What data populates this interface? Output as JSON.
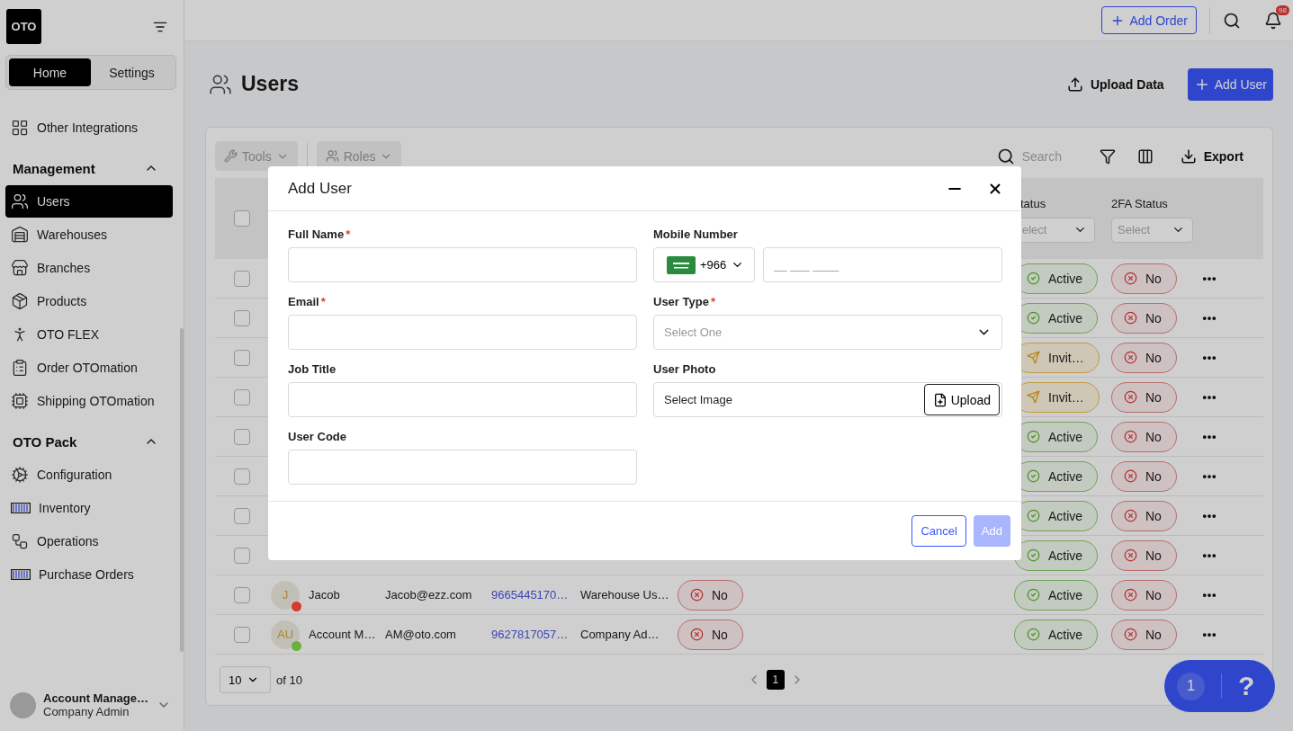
{
  "sidebar": {
    "logo": "OTO",
    "tabs": [
      {
        "label": "Home",
        "selected": true
      },
      {
        "label": "Settings",
        "selected": false
      }
    ],
    "groups": [
      {
        "items": [
          {
            "label": "Other Integrations",
            "selected": false
          }
        ]
      },
      {
        "title": "Management",
        "expanded": true,
        "items": [
          {
            "label": "Users",
            "selected": true
          },
          {
            "label": "Warehouses",
            "selected": false
          },
          {
            "label": "Branches",
            "selected": false
          },
          {
            "label": "Products",
            "selected": false
          },
          {
            "label": "OTO FLEX",
            "selected": false
          },
          {
            "label": "Order OTOmation",
            "selected": false
          },
          {
            "label": "Shipping OTOmation",
            "selected": false
          }
        ]
      },
      {
        "title": "OTO Pack",
        "expanded": true,
        "items": [
          {
            "label": "Configuration",
            "selected": false
          },
          {
            "label": "Inventory",
            "selected": false
          },
          {
            "label": "Operations",
            "selected": false
          },
          {
            "label": "Purchase Orders",
            "selected": false
          }
        ]
      }
    ],
    "account": {
      "name": "Account Manage…",
      "role": "Company Admin"
    }
  },
  "header": {
    "add_order": "Add Order",
    "notification_count": "98"
  },
  "page": {
    "title": "Users",
    "upload": "Upload Data",
    "add": "Add User"
  },
  "toolbar": {
    "tools": "Tools",
    "roles": "Roles",
    "search_placeholder": "Search",
    "export": "Export"
  },
  "table": {
    "header_checked": false,
    "columns": [
      {
        "label": "tatus",
        "filter_placeholder": "elect"
      },
      {
        "label": "2FA Status",
        "filter_placeholder": "Select"
      }
    ],
    "rows": [
      {
        "checked": false,
        "status": {
          "text": "Active",
          "kind": "active"
        },
        "twofa": {
          "text": "No",
          "kind": "no"
        }
      },
      {
        "checked": false,
        "status": {
          "text": "Active",
          "kind": "active"
        },
        "twofa": {
          "text": "No",
          "kind": "no"
        }
      },
      {
        "checked": false,
        "status": {
          "text": "Invit…",
          "kind": "invited"
        },
        "twofa": {
          "text": "No",
          "kind": "no"
        }
      },
      {
        "checked": false,
        "status": {
          "text": "Invit…",
          "kind": "invited"
        },
        "twofa": {
          "text": "No",
          "kind": "no"
        }
      },
      {
        "checked": false,
        "status": {
          "text": "Active",
          "kind": "active"
        },
        "twofa": {
          "text": "No",
          "kind": "no"
        }
      },
      {
        "checked": false,
        "status": {
          "text": "Active",
          "kind": "active"
        },
        "twofa": {
          "text": "No",
          "kind": "no"
        }
      },
      {
        "checked": false,
        "status": {
          "text": "Active",
          "kind": "active"
        },
        "twofa": {
          "text": "No",
          "kind": "no"
        }
      },
      {
        "checked": false,
        "status": {
          "text": "Active",
          "kind": "active"
        },
        "twofa": {
          "text": "No",
          "kind": "no"
        }
      },
      {
        "checked": false,
        "initials": "J",
        "color": "#d63a2f",
        "name": "Jacob",
        "email": "Jacob@ezz.com",
        "phone": "9665445170…",
        "user_type": "Warehouse Us…",
        "flag": {
          "text": "No",
          "kind": "no"
        },
        "status": {
          "text": "Active",
          "kind": "active"
        },
        "twofa": {
          "text": "No",
          "kind": "no"
        }
      },
      {
        "checked": false,
        "initials": "AU",
        "color": "#6ab23a",
        "name": "Account M…",
        "email": "AM@oto.com",
        "phone": "9627817057…",
        "user_type": "Company Ad…",
        "flag": {
          "text": "No",
          "kind": "no"
        },
        "status": {
          "text": "Active",
          "kind": "active"
        },
        "twofa": {
          "text": "No",
          "kind": "no"
        }
      }
    ]
  },
  "pagination": {
    "page_size": "10",
    "total": "of 10",
    "pages": [
      {
        "label": "1",
        "selected": true
      }
    ]
  },
  "help": {
    "count": "1",
    "label": "?"
  },
  "modal": {
    "title": "Add User",
    "fields": [
      {
        "kind": "text",
        "label": "Full Name",
        "required_mark": "*"
      },
      {
        "kind": "phone",
        "label": "Mobile Number",
        "country_code": "+966",
        "placeholder": "__ ___ ____"
      },
      {
        "kind": "text",
        "label": "Email",
        "required_mark": "*"
      },
      {
        "kind": "select",
        "label": "User Type",
        "required_mark": "*",
        "placeholder": "Select One"
      },
      {
        "kind": "text",
        "label": "Job Title"
      },
      {
        "kind": "file",
        "label": "User Photo",
        "value": "Select Image",
        "button": "Upload"
      },
      {
        "kind": "text",
        "label": "User Code"
      }
    ],
    "buttons": [
      {
        "label": "Cancel",
        "kind": "secondary",
        "disabled": false
      },
      {
        "label": "Add",
        "kind": "primary",
        "disabled": true
      }
    ]
  }
}
